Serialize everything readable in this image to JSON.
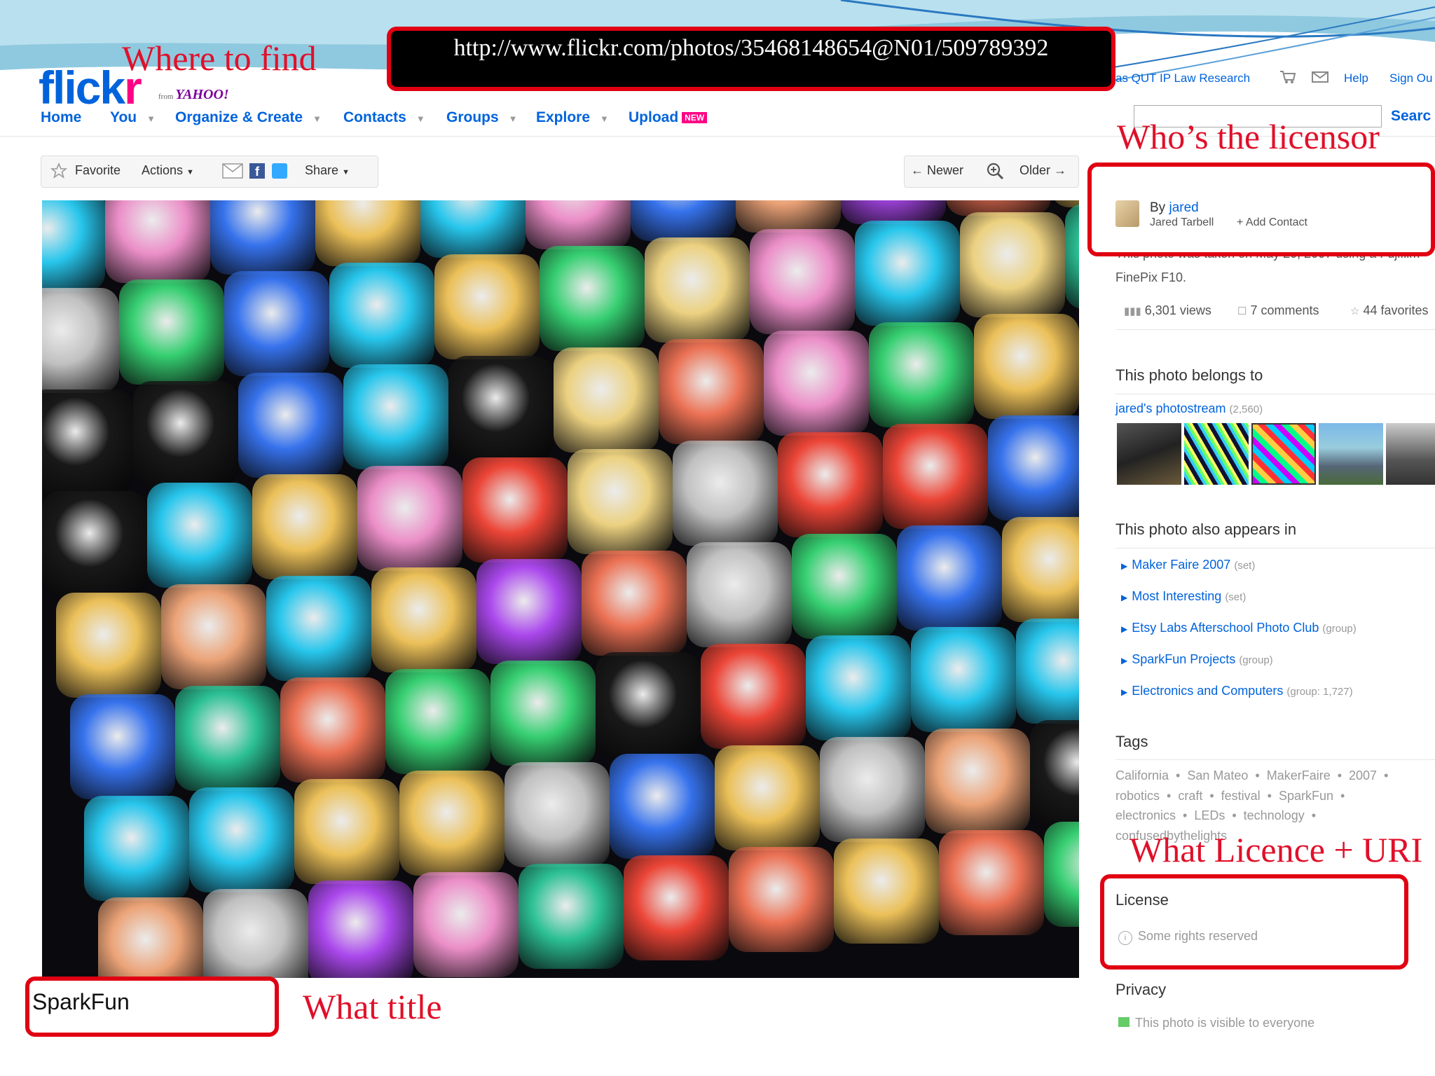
{
  "header": {
    "logo_blue": "flick",
    "logo_pink": "r",
    "logo_from": "from",
    "logo_yahoo": "YAHOO!",
    "signed_in_as": "as QUT IP Law Research",
    "help": "Help",
    "sign_out": "Sign Ou",
    "search_button": "Searc",
    "nav": [
      {
        "label": "Home"
      },
      {
        "label": "You"
      },
      {
        "label": "Organize & Create"
      },
      {
        "label": "Contacts"
      },
      {
        "label": "Groups"
      },
      {
        "label": "Explore"
      },
      {
        "label": "Upload"
      }
    ],
    "upload_badge": "NEW"
  },
  "actions": {
    "favorite": "Favorite",
    "actions": "Actions",
    "share": "Share",
    "newer": "Newer",
    "older": "Older"
  },
  "photo": {
    "title": "SparkFun"
  },
  "owner": {
    "by": "By",
    "username": "jared",
    "real_name": "Jared Tarbell",
    "add_contact": "+ Add Contact"
  },
  "meta": {
    "taken_partial": "This photo was taken on May 20, 2007 using a Fujifilm",
    "camera": "FinePix F10.",
    "views": "6,301 views",
    "comments": "7 comments",
    "favorites": "44 favorites"
  },
  "belongs": {
    "heading": "This photo belongs to",
    "photostream": "jared's photostream",
    "count": "(2,560)"
  },
  "appears": {
    "heading": "This photo also appears in",
    "items": [
      {
        "name": "Maker Faire 2007",
        "kind": "(set)"
      },
      {
        "name": "Most Interesting",
        "kind": "(set)"
      },
      {
        "name": "Etsy Labs Afterschool Photo Club",
        "kind": "(group)"
      },
      {
        "name": "SparkFun Projects",
        "kind": "(group)"
      },
      {
        "name": "Electronics and Computers",
        "kind": "(group: 1,727)"
      }
    ]
  },
  "tags": {
    "heading": "Tags",
    "line1": "California  •  San Mateo  •  MakerFaire  •  2007  •",
    "line2": "robotics  •  craft  •  festival  •  SparkFun  •",
    "line3": "electronics  •  LEDs  •  technology  •",
    "line4": "confusedbythelights"
  },
  "license": {
    "heading": "License",
    "value": "Some rights reserved"
  },
  "privacy": {
    "heading": "Privacy",
    "value": "This photo is visible to everyone"
  },
  "annotations": {
    "where": "Where to find",
    "url": "http://www.flickr.com/photos/35468148654@N01/509789392",
    "who": "Who’s the licensor",
    "what_licence": "What Licence + URI",
    "what_title": "What title"
  },
  "colors": {
    "flickr_blue": "#0063dc",
    "flickr_pink": "#ff0084",
    "annotation_red": "#e00012"
  }
}
